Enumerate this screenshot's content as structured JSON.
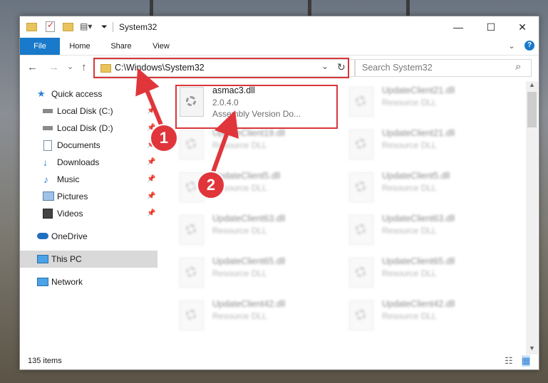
{
  "window": {
    "title": "System32",
    "minimize_glyph": "—",
    "maximize_glyph": "☐",
    "close_glyph": "✕"
  },
  "ribbon": {
    "tabs": [
      "File",
      "Home",
      "Share",
      "View"
    ],
    "expand_glyph": "⌄",
    "help_glyph": "?"
  },
  "nav": {
    "back_glyph": "←",
    "forward_glyph": "→",
    "recent_glyph": "⌄",
    "up_glyph": "↑",
    "address": "C:\\Windows\\System32",
    "address_dropdown_glyph": "⌄",
    "refresh_glyph": "↻",
    "search_placeholder": "Search System32",
    "search_glyph": "⌕"
  },
  "sidebar": {
    "items": [
      {
        "label": "Quick access",
        "icon": "star-icon",
        "pinned": false
      },
      {
        "label": "Local Disk (C:)",
        "icon": "drive-icon",
        "pinned": true
      },
      {
        "label": "Local Disk (D:)",
        "icon": "drive-icon",
        "pinned": true
      },
      {
        "label": "Documents",
        "icon": "documents-icon",
        "pinned": true
      },
      {
        "label": "Downloads",
        "icon": "downloads-icon",
        "pinned": true
      },
      {
        "label": "Music",
        "icon": "music-icon",
        "pinned": true
      },
      {
        "label": "Pictures",
        "icon": "pictures-icon",
        "pinned": true
      },
      {
        "label": "Videos",
        "icon": "videos-icon",
        "pinned": true
      },
      {
        "label": "OneDrive",
        "icon": "cloud-icon",
        "pinned": false
      },
      {
        "label": "This PC",
        "icon": "computer-icon",
        "pinned": false
      },
      {
        "label": "Network",
        "icon": "network-icon",
        "pinned": false
      }
    ],
    "pin_glyph": "📌"
  },
  "files": [
    {
      "name": "asmac3.dll",
      "line2": "2.0.4.0",
      "line3": "Assembly Version Do..."
    },
    {
      "name": "UpdateClient21.dll",
      "line2": "Resource DLL"
    },
    {
      "name": "UpdateClient19.dll",
      "line2": "Resource DLL"
    },
    {
      "name": "UpdateClient21.dll",
      "line2": "Resource DLL"
    },
    {
      "name": "UpdateClient5.dll",
      "line2": "Resource DLL"
    },
    {
      "name": "UpdateClient5.dll",
      "line2": "Resource DLL"
    },
    {
      "name": "UpdateClient63.dll",
      "line2": "Resource DLL"
    },
    {
      "name": "UpdateClient63.dll",
      "line2": "Resource DLL"
    },
    {
      "name": "UpdateClient65.dll",
      "line2": "Resource DLL"
    },
    {
      "name": "UpdateClient65.dll",
      "line2": "Resource DLL"
    },
    {
      "name": "UpdateClient42.dll",
      "line2": "Resource DLL"
    },
    {
      "name": "UpdateClient42.dll",
      "line2": "Resource DLL"
    }
  ],
  "status": {
    "item_count": "135 items",
    "details_view_glyph": "☷",
    "tiles_view_glyph": "▦"
  },
  "annotations": {
    "step1": "1",
    "step2": "2",
    "color": "#e0363b"
  }
}
